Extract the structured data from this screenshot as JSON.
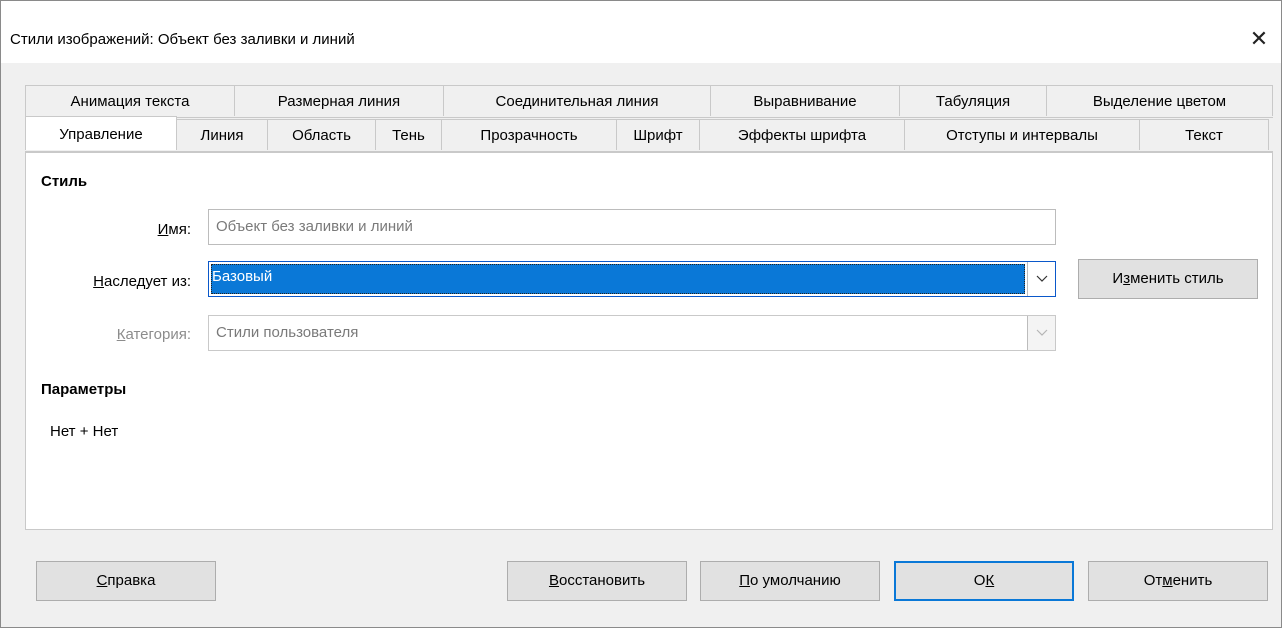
{
  "window": {
    "title": "Стили изображений: Объект без заливки и линий",
    "close_glyph": "✕"
  },
  "tabs_row1": [
    "Анимация текста",
    "Размерная линия",
    "Соединительная линия",
    "Выравнивание",
    "Табуляция",
    "Выделение цветом"
  ],
  "tabs_row2": [
    "Управление",
    "Линия",
    "Область",
    "Тень",
    "Прозрачность",
    "Шрифт",
    "Эффекты шрифта",
    "Отступы и интервалы",
    "Текст"
  ],
  "active_tab": "Управление",
  "style_section": {
    "heading": "Стиль",
    "name_label_u": "И",
    "name_label_rest": "мя:",
    "name_value": "Объект без заливки и линий",
    "inherit_label_u": "Н",
    "inherit_label_rest": "аследует из:",
    "inherit_value": "Базовый",
    "category_label_u": "К",
    "category_label_rest": "атегория:",
    "category_value": "Стили пользователя",
    "edit_style_pre": "И",
    "edit_style_u": "з",
    "edit_style_post": "менить стиль"
  },
  "params_section": {
    "heading": "Параметры",
    "value": "Нет + Нет"
  },
  "buttons": {
    "help_u": "С",
    "help_rest": "правка",
    "reset_u": "В",
    "reset_rest": "осстановить",
    "default_u": "П",
    "default_rest": "о умолчанию",
    "ok_pre": "О",
    "ok_u": "К",
    "cancel_pre": "От",
    "cancel_u": "м",
    "cancel_post": "енить"
  },
  "colors": {
    "accent": "#0a78d7",
    "panel_bg": "#ffffff",
    "dialog_bg": "#f0f0f0"
  }
}
